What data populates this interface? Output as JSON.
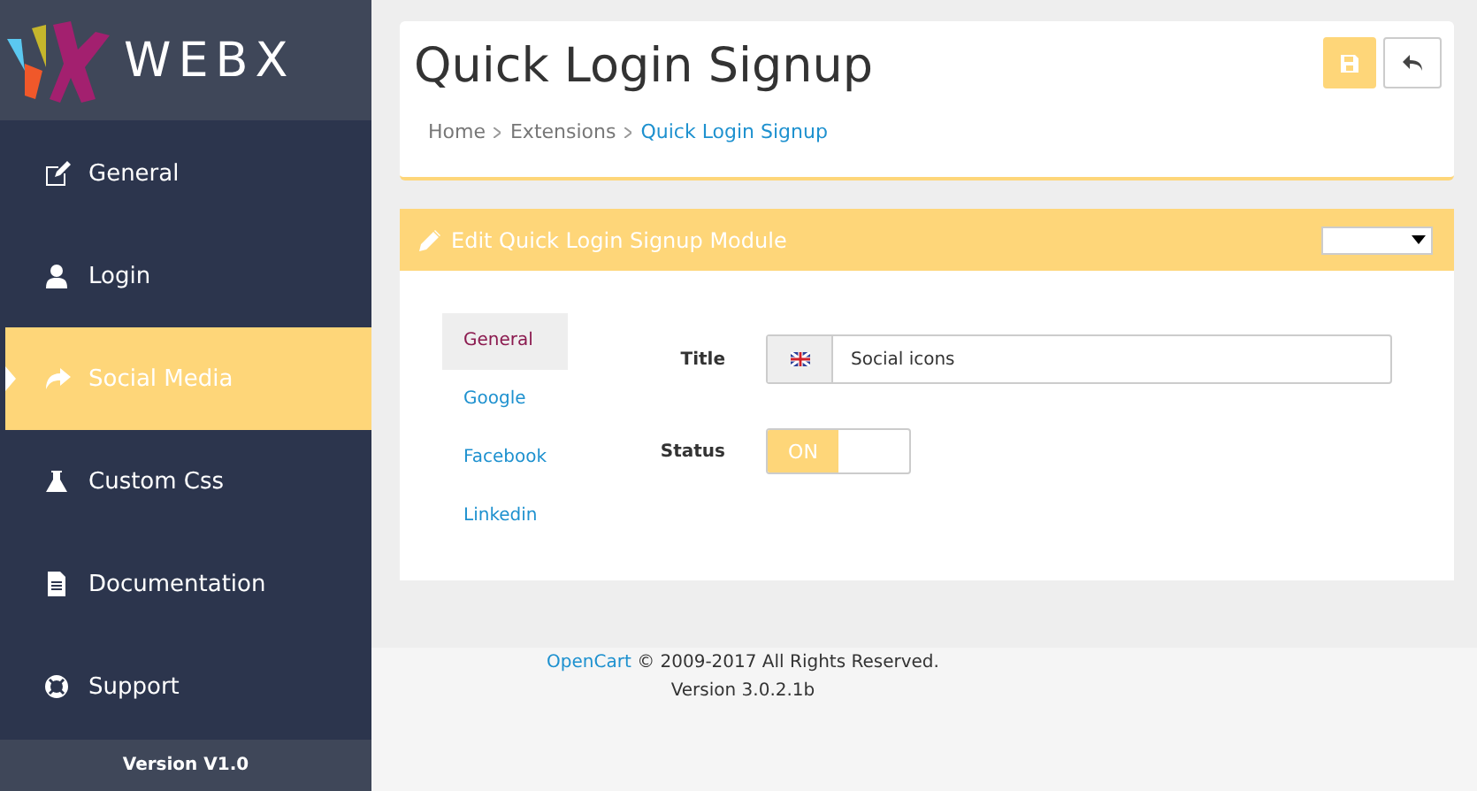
{
  "sidebar": {
    "logo": "WEBX",
    "items": [
      {
        "label": "General",
        "selected": false
      },
      {
        "label": "Login",
        "selected": false
      },
      {
        "label": "Social Media",
        "selected": true
      },
      {
        "label": "Custom Css",
        "selected": false
      },
      {
        "label": "Documentation",
        "selected": false
      },
      {
        "label": "Support",
        "selected": false
      }
    ],
    "version": "Version V1.0"
  },
  "header": {
    "title": "Quick Login Signup",
    "breadcrumb": [
      {
        "label": "Home",
        "current": false
      },
      {
        "label": "Extensions",
        "current": false
      },
      {
        "label": "Quick Login Signup",
        "current": true
      }
    ]
  },
  "panel": {
    "title": "Edit Quick Login Signup Module",
    "tabs": [
      {
        "label": "General",
        "selected": true
      },
      {
        "label": "Google",
        "selected": false
      },
      {
        "label": "Facebook",
        "selected": false
      },
      {
        "label": "Linkedin",
        "selected": false
      }
    ],
    "fields": [
      {
        "kind": "text",
        "label": "Title",
        "value": "Social icons"
      },
      {
        "kind": "toggle",
        "label": "Status",
        "on": true,
        "on_text": "ON"
      }
    ]
  },
  "footer": {
    "link": "OpenCart",
    "text": " © 2009-2017 All Rights Reserved.",
    "version": "Version 3.0.2.1b"
  }
}
